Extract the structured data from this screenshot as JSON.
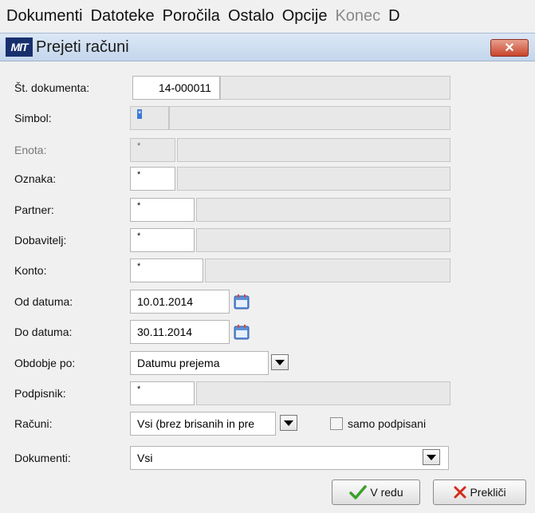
{
  "menu": [
    "Dokumenti",
    "Datoteke",
    "Poročila",
    "Ostalo",
    "Opcije"
  ],
  "menu_disabled": [
    "Konec",
    "D"
  ],
  "window": {
    "logo_text": "MIT",
    "title": "Prejeti računi",
    "close_label": "✕"
  },
  "form": {
    "st_dokumenta": {
      "label": "Št. dokumenta:",
      "value": "14-000011"
    },
    "simbol": {
      "label": "Simbol:",
      "value": "*"
    },
    "enota": {
      "label": "Enota:",
      "value": "*"
    },
    "oznaka": {
      "label": "Oznaka:",
      "value": "*"
    },
    "partner": {
      "label": "Partner:",
      "value": "*"
    },
    "dobavitelj": {
      "label": "Dobavitelj:",
      "value": "*"
    },
    "konto": {
      "label": "Konto:",
      "value": "*"
    },
    "od_datuma": {
      "label": "Od datuma:",
      "value": "10.01.2014"
    },
    "do_datuma": {
      "label": "Do datuma:",
      "value": "30.11.2014"
    },
    "obdobje_po": {
      "label": "Obdobje po:",
      "value": "Datumu prejema"
    },
    "podpisnik": {
      "label": "Podpisnik:",
      "value": "*"
    },
    "racuni": {
      "label": "Računi:",
      "value": "Vsi (brez brisanih in pre"
    },
    "samo_podpisani": {
      "label": "samo podpisani",
      "checked": false
    },
    "dokumenti": {
      "label": "Dokumenti:",
      "value": "Vsi"
    }
  },
  "buttons": {
    "ok": "V redu",
    "cancel": "Prekliči"
  },
  "icons": {
    "calendar": "calendar-icon",
    "ok": "checkmark-icon",
    "cancel": "x-icon"
  },
  "colors": {
    "title_bar": "#c9d9ee",
    "close_button": "#c8452c",
    "selection": "#3a7ad6",
    "ok_check": "#3aa02a",
    "cancel_x": "#d42a1a"
  }
}
